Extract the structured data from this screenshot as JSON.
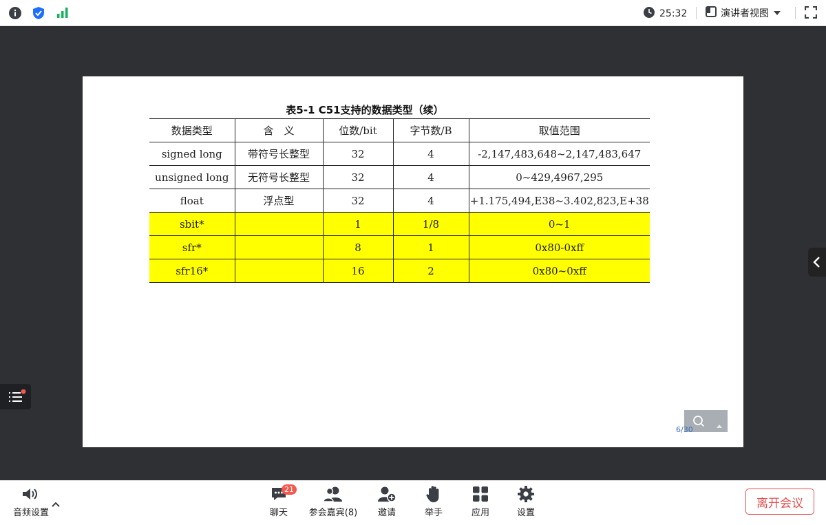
{
  "topbar": {
    "timer": "25:32",
    "view_mode": "演讲者视图",
    "icons": [
      "info-icon",
      "shield-icon",
      "signal-icon",
      "clock-icon",
      "layout-icon",
      "caret-down-icon",
      "fullscreen-icon"
    ]
  },
  "slide": {
    "title_prefix": "表",
    "title_num": "5-1  C51",
    "title_rest": "支持的数据类型（续）",
    "table": {
      "headers": [
        "数据类型",
        "含　义",
        "位数/bit",
        "字节数/B",
        "取值范围"
      ],
      "rows": [
        [
          "signed long",
          "带符号长整型",
          "32",
          "4",
          "-2,147,483,648~2,147,483,647"
        ],
        [
          "unsigned long",
          "无符号长整型",
          "32",
          "4",
          "0~429,4967,295"
        ],
        [
          "float",
          "浮点型",
          "32",
          "4",
          "+1.175,494,E38~3.402,823,E+38"
        ],
        [
          "sbit*",
          "",
          "1",
          "1/8",
          "0~1"
        ],
        [
          "sfr*",
          "",
          "8",
          "1",
          "0x80-0xff"
        ],
        [
          "sfr16*",
          "",
          "16",
          "2",
          "0x80~0xff"
        ]
      ],
      "highlight_color": "#ffff00"
    },
    "page_indicator": "6/30"
  },
  "toolbar": {
    "audio": "音频设置",
    "chat": "聊天",
    "chat_badge": "21",
    "participants": "参会嘉宾(8)",
    "invite": "邀请",
    "raise_hand": "举手",
    "apps": "应用",
    "settings": "设置",
    "leave": "离开会议"
  },
  "colors": {
    "stage_bg": "#2e3033",
    "leave_red": "#e14e4e",
    "badge_red": "#f05a4f",
    "shield_blue": "#1e6fff",
    "signal_green": "#16b35b"
  }
}
